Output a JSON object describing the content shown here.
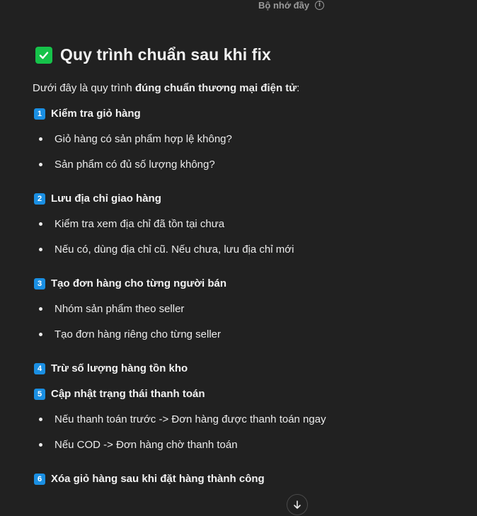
{
  "memory_notice": {
    "label": "Bộ nhớ đầy",
    "icon": "info-icon"
  },
  "heading": {
    "icon": "check-mark-button-icon",
    "title": "Quy trình chuẩn sau khi fix"
  },
  "intro": {
    "prefix": "Dưới đây là quy trình ",
    "bold": "đúng chuẩn thương mại điện tử",
    "suffix": ":"
  },
  "steps": [
    {
      "number": "1",
      "title": "Kiểm tra giỏ hàng",
      "bullets": [
        "Giỏ hàng có sản phẩm hợp lệ không?",
        "Sản phẩm có đủ số lượng không?"
      ]
    },
    {
      "number": "2",
      "title": "Lưu địa chỉ giao hàng",
      "bullets": [
        "Kiểm tra xem địa chỉ đã tồn tại chưa",
        "Nếu có, dùng địa chỉ cũ. Nếu chưa, lưu địa chỉ mới"
      ]
    },
    {
      "number": "3",
      "title": "Tạo đơn hàng cho từng người bán",
      "bullets": [
        "Nhóm sản phẩm theo seller",
        "Tạo đơn hàng riêng cho từng seller"
      ]
    },
    {
      "number": "4",
      "title": "Trừ số lượng hàng tồn kho",
      "bullets": []
    },
    {
      "number": "5",
      "title": "Cập nhật trạng thái thanh toán",
      "bullets": [
        "Nếu thanh toán trước -> Đơn hàng được thanh toán ngay",
        "Nếu COD -> Đơn hàng chờ thanh toán"
      ]
    },
    {
      "number": "6",
      "title": "Xóa giỏ hàng sau khi đặt hàng thành công",
      "bullets": []
    }
  ],
  "scroll_button": {
    "icon": "arrow-down-icon"
  },
  "colors": {
    "background": "#212121",
    "text": "#ececec",
    "check_green": "#16c24a",
    "keycap_blue": "#1a8fe3"
  }
}
